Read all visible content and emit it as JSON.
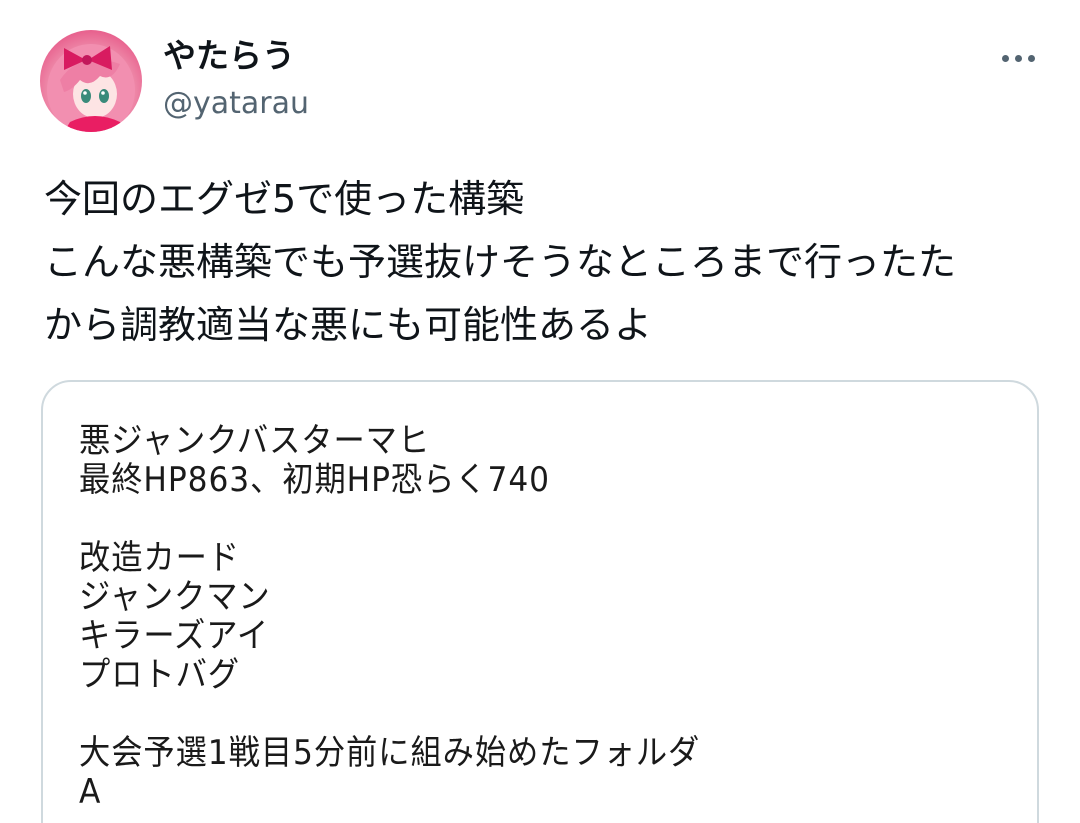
{
  "author": {
    "display_name": "やたらう",
    "handle": "@yatarau"
  },
  "tweet": {
    "lines": [
      "今回のエグゼ5で使った構築",
      "こんな悪構築でも予選抜けそうなところまで行ったた",
      "から調教適当な悪にも可能性あるよ"
    ]
  },
  "attachment": {
    "lines": [
      "悪ジャンクバスターマヒ",
      "最終HP863、初期HP恐らく740",
      "",
      "改造カード",
      "ジャンクマン",
      "キラーズアイ",
      "プロトバグ",
      "",
      "大会予選1戦目5分前に組み始めたフォルダ",
      "A"
    ]
  },
  "icons": {
    "more": "more-horizontal-icon",
    "avatar": "anime-girl-pink-hair-avatar"
  },
  "colors": {
    "text_primary": "#0f1419",
    "text_secondary": "#536471",
    "card_border": "#cfd9de"
  }
}
